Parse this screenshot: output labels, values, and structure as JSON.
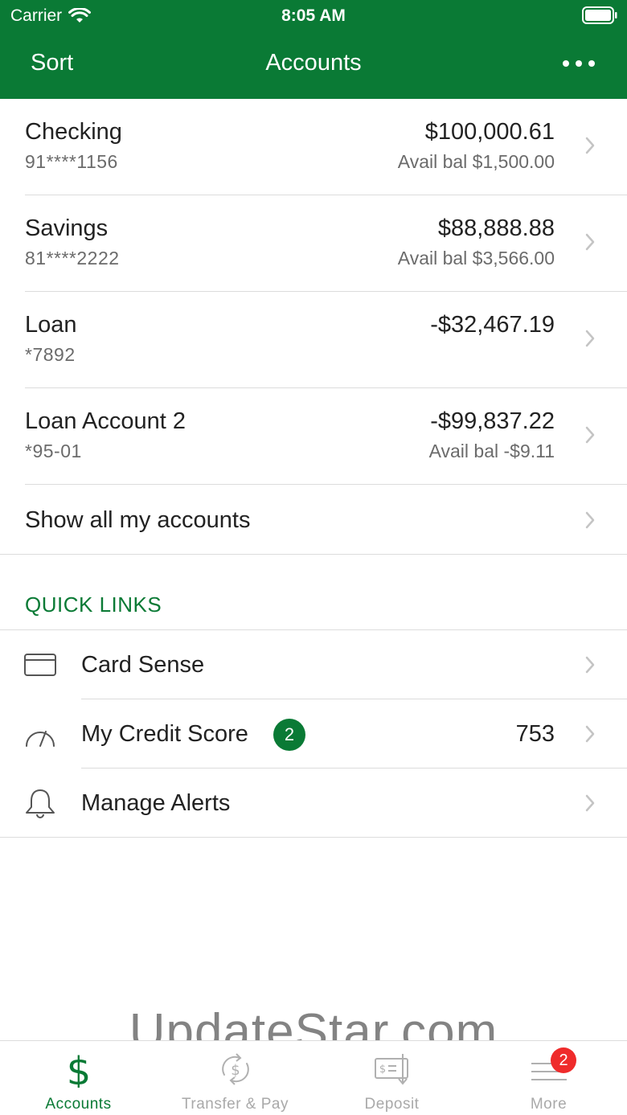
{
  "status_bar": {
    "carrier": "Carrier",
    "time": "8:05 AM"
  },
  "nav": {
    "sort_label": "Sort",
    "title": "Accounts"
  },
  "accounts": [
    {
      "name": "Checking",
      "number": "91****1156",
      "balance": "$100,000.61",
      "avail": "Avail bal $1,500.00"
    },
    {
      "name": "Savings",
      "number": "81****2222",
      "balance": "$88,888.88",
      "avail": "Avail bal $3,566.00"
    },
    {
      "name": "Loan",
      "number": "*7892",
      "balance": "-$32,467.19",
      "avail": ""
    },
    {
      "name": "Loan Account 2",
      "number": "*95-01",
      "balance": "-$99,837.22",
      "avail": "Avail bal -$9.11"
    }
  ],
  "show_all_label": "Show all my accounts",
  "quick_links": {
    "title": "QUICK LINKS",
    "items": [
      {
        "label": "Card Sense",
        "icon": "card-icon"
      },
      {
        "label": "My Credit Score",
        "icon": "gauge-icon",
        "badge": "2",
        "value": "753"
      },
      {
        "label": "Manage Alerts",
        "icon": "bell-icon"
      }
    ]
  },
  "watermark": "UpdateStar.com",
  "tabs": [
    {
      "label": "Accounts",
      "icon": "dollar-icon",
      "active": true
    },
    {
      "label": "Transfer & Pay",
      "icon": "transfer-icon"
    },
    {
      "label": "Deposit",
      "icon": "deposit-check-icon"
    },
    {
      "label": "More",
      "icon": "menu-icon",
      "badge": "2"
    }
  ],
  "colors": {
    "brand": "#0a7a35",
    "badge_red": "#ef2b2b",
    "text_secondary": "#6b6b6b",
    "tab_inactive": "#a9a9a9"
  }
}
